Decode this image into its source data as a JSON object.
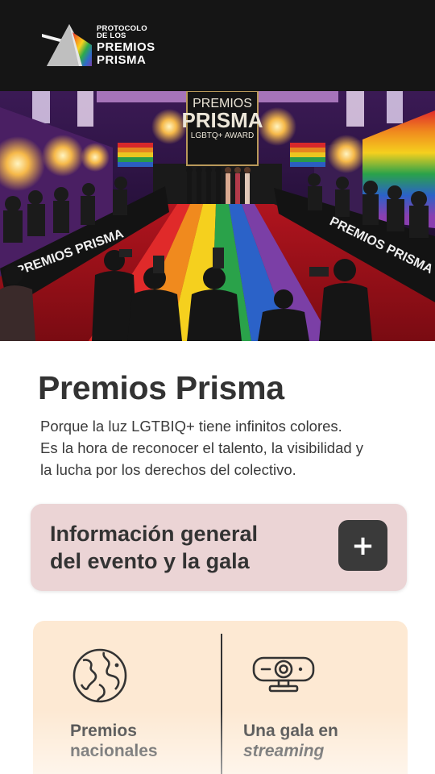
{
  "header": {
    "logo_line1": "PROTOCOLO",
    "logo_line2": "DE LOS",
    "logo_line3": "PREMIOS",
    "logo_line4": "PRISMA",
    "logo_icon": "prism-icon"
  },
  "hero": {
    "backdrop_title": "PREMIOS",
    "backdrop_sub": "PRISMA",
    "backdrop_tag": "LGBTQ+ AWARD",
    "barrier_text_left": "PREMIOS PRISMA",
    "barrier_text_right": "PREMIOS PRISMA"
  },
  "main": {
    "title": "Premios Prisma",
    "intro_lines": [
      "Porque la luz LGTBIQ+ tiene infinitos colores.",
      "Es la hora de reconocer el talento, la visibilidad y",
      "la lucha por los derechos del colectivo."
    ]
  },
  "accordion": {
    "label_line1": "Información general",
    "label_line2": "del evento y la gala",
    "toggle_symbol": "+",
    "toggle_icon": "plus-icon",
    "background": "#ebd4d5"
  },
  "features": [
    {
      "icon": "globe-icon",
      "line1": "Premios",
      "line2": "nacionales"
    },
    {
      "icon": "webcam-icon",
      "line1": "Una gala en",
      "line2": "streaming"
    }
  ],
  "colors": {
    "header_bg": "#151515",
    "features_bg": "#fde9d3",
    "text": "#333333"
  }
}
